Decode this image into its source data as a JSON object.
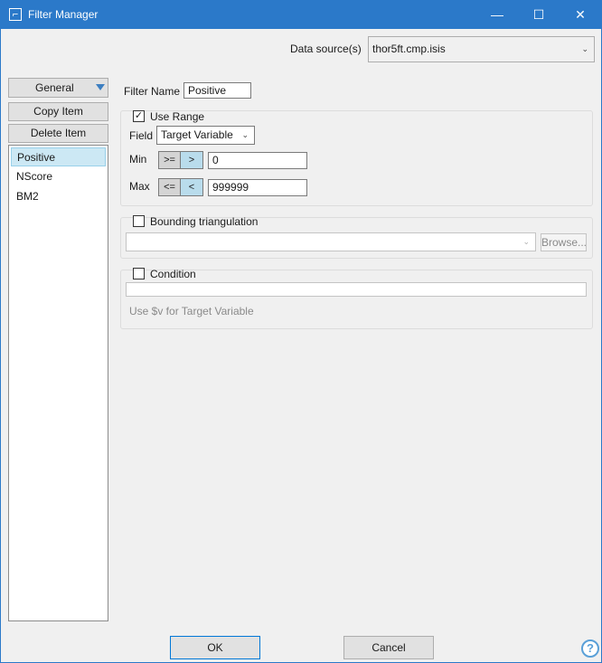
{
  "window": {
    "title": "Filter Manager",
    "minimize_glyph": "—",
    "maximize_glyph": "☐",
    "close_glyph": "✕",
    "icon": "filter-chart-icon"
  },
  "data_source": {
    "label": "Data source(s)",
    "value": "thor5ft.cmp.isis"
  },
  "sidebar": {
    "general_label": "General",
    "copy_label": "Copy Item",
    "delete_label": "Delete Item",
    "items": [
      {
        "label": "Positive",
        "selected": true
      },
      {
        "label": "NScore",
        "selected": false
      },
      {
        "label": "BM2",
        "selected": false
      }
    ]
  },
  "filter": {
    "name_label": "Filter Name",
    "name_value": "Positive"
  },
  "range": {
    "use_range_label": "Use Range",
    "checked": true,
    "field_label": "Field",
    "field_value": "Target Variable",
    "min_label": "Min",
    "min_ops": [
      ">=",
      ">"
    ],
    "min_selected": ">",
    "min_value": "0",
    "max_label": "Max",
    "max_ops": [
      "<=",
      "<"
    ],
    "max_selected": "<",
    "max_value": "999999"
  },
  "bounding": {
    "label": "Bounding triangulation",
    "checked": false,
    "browse_label": "Browse..."
  },
  "condition": {
    "label": "Condition",
    "checked": false,
    "hint": "Use $v for Target Variable"
  },
  "footer": {
    "ok_label": "OK",
    "cancel_label": "Cancel",
    "help_glyph": "?"
  },
  "colors": {
    "titlebar": "#2b79c9",
    "selection": "#cce8f4",
    "accent": "#5aa0d8"
  }
}
